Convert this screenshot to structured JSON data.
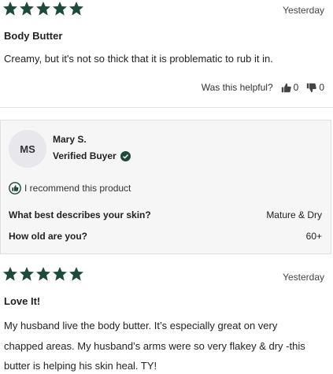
{
  "reviews": [
    {
      "rating": 5,
      "date": "Yesterday",
      "title": "Body Butter",
      "body": "Creamy, but it's not so thick that it is problematic to rub it in.",
      "helpful_label": "Was this helpful?",
      "helpful_yes": "0",
      "helpful_no": "0"
    },
    {
      "rating": 5,
      "date": "Yesterday",
      "title": "Love It!",
      "body_lines": [
        "My husband live the body butter. It’s especially great on very",
        "chapped areas. My husband’s arms were so very flakey & dry -this",
        "butter is helping his skin heal. TY!"
      ]
    }
  ],
  "reviewer": {
    "initials": "MS",
    "name": "Mary S.",
    "badge": "Verified Buyer",
    "recommend": "I recommend this product",
    "questions": [
      {
        "q": "What best describes your skin?",
        "a": "Mature & Dry"
      },
      {
        "q": "How old are you?",
        "a": "60+"
      }
    ]
  },
  "colors": {
    "star": "#1d4a3a",
    "accent": "#1d4a3a"
  },
  "icons": {
    "star": "star-icon",
    "thumbs_up": "thumbs-up-icon",
    "thumbs_down": "thumbs-down-icon",
    "verified": "check-circle-icon",
    "recommend": "thumbs-up-circle-icon"
  }
}
